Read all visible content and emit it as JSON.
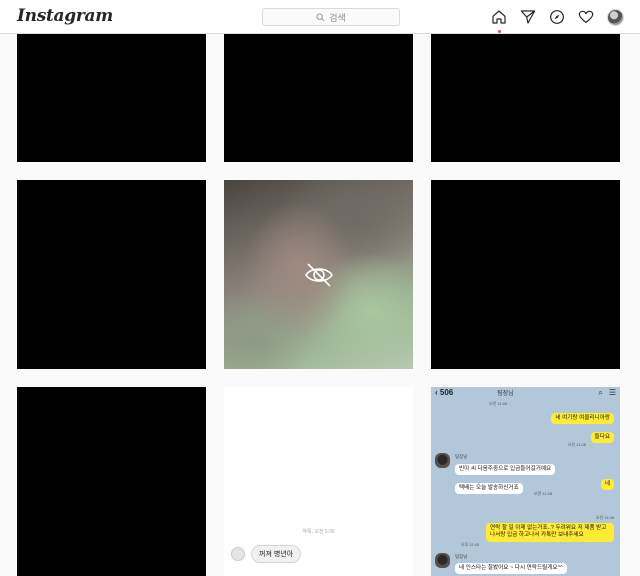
{
  "header": {
    "logo": "Instagram",
    "search_placeholder": "검색",
    "nav": [
      {
        "name": "home-icon"
      },
      {
        "name": "direct-message-icon"
      },
      {
        "name": "explore-icon"
      },
      {
        "name": "activity-heart-icon"
      },
      {
        "name": "profile-avatar"
      }
    ],
    "active_dot_color": "#ed4956"
  },
  "grid": {
    "hidden_icon": "eye-slash-icon",
    "chat_tile": {
      "caption": "약목, 오전 5:06",
      "message": "꺼져 병년아"
    },
    "kakao_tile": {
      "back_label": "506",
      "title": "팀장님",
      "time_top": "오전 11:00",
      "messages": [
        {
          "side": "right",
          "text": "네 여기랑 여클리니아랑"
        },
        {
          "side": "right",
          "text": "들다요"
        },
        {
          "side": "left_name",
          "text": "팀장님"
        },
        {
          "side": "left",
          "text": "빈아 씨 다음주중으로 입금들어갈거예요"
        },
        {
          "side": "left",
          "text": "택배는 오늘 발송하신거죠"
        },
        {
          "side": "right",
          "text": "네"
        },
        {
          "side": "right",
          "text": "연락 할 일 이제 없는거죠..? 두려워요 저 제품 받고 나서랑 입금 하고나서 카톡만 보내주세요"
        },
        {
          "side": "left_name",
          "text": "팀장님"
        },
        {
          "side": "left",
          "text": "네 인스타는 잘봤어요 ~ 다시 연락드릴게요^^"
        }
      ],
      "times": [
        "오전 11:08",
        "오전 11:28",
        "오전 11:28",
        "오전 11:36",
        "오후 11:40",
        "오후 11:48"
      ]
    }
  }
}
